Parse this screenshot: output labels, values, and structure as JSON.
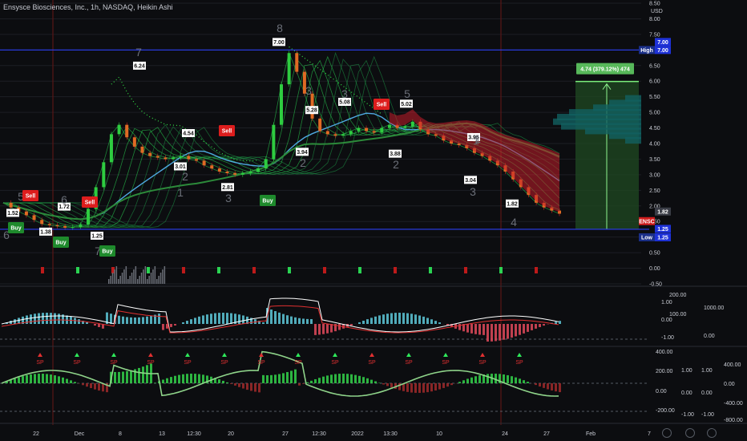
{
  "header": {
    "title": "Ensysce Biosciences, Inc., 1h, NASDAQ, Heikin Ashi",
    "currency": "USD"
  },
  "colors": {
    "background": "#0c0d10",
    "up": "#2ecc40",
    "down": "#e02424",
    "level_line": "#2b3ef0",
    "target_box": "#1f4a22",
    "target_label": "#57b85a"
  },
  "chart_data": {
    "type": "line",
    "price_axis": {
      "ticks": [
        "8.50",
        "8.00",
        "7.50",
        "7.00",
        "6.50",
        "6.00",
        "5.50",
        "5.00",
        "4.50",
        "4.00",
        "3.50",
        "3.00",
        "2.50",
        "2.00",
        "1.50",
        "1.00",
        "0.50",
        "0.00",
        "-0.50"
      ],
      "ylim": [
        -0.5,
        8.5
      ]
    },
    "time_axis": {
      "ticks": [
        "22",
        "Dec",
        "8",
        "13",
        "12:30",
        "20",
        "27",
        "12:30",
        "2022",
        "13:30",
        "10",
        "24",
        "27",
        "Feb",
        "7"
      ]
    },
    "price_series": [
      2.1,
      1.95,
      1.82,
      1.7,
      1.55,
      1.42,
      1.38,
      1.35,
      1.3,
      1.32,
      1.4,
      1.9,
      2.6,
      3.4,
      4.3,
      4.6,
      4.2,
      3.9,
      3.7,
      3.6,
      3.55,
      3.5,
      3.55,
      3.6,
      3.5,
      3.45,
      3.3,
      3.2,
      3.1,
      3.05,
      3.0,
      3.05,
      3.1,
      3.2,
      3.5,
      4.6,
      5.9,
      6.9,
      6.3,
      5.6,
      4.8,
      4.4,
      4.3,
      4.25,
      4.3,
      4.4,
      4.5,
      4.4,
      4.35,
      4.5,
      4.6,
      4.5,
      4.55,
      4.7,
      4.45,
      4.3,
      4.25,
      4.1,
      4.0,
      3.95,
      3.85,
      3.7,
      3.6,
      3.45,
      3.3,
      3.1,
      2.85,
      2.6,
      2.35,
      2.1,
      1.95,
      1.85,
      1.75
    ],
    "price_labels": [
      {
        "text": "1.52",
        "value": 1.52
      },
      {
        "text": "1.38",
        "value": 1.38
      },
      {
        "text": "1.72",
        "value": 1.72
      },
      {
        "text": "1.25",
        "value": 1.25
      },
      {
        "text": "6.24",
        "value": 6.24
      },
      {
        "text": "4.54",
        "value": 4.54
      },
      {
        "text": "3.01",
        "value": 3.01
      },
      {
        "text": "2.81",
        "value": 2.81
      },
      {
        "text": "7.00",
        "value": 7.0
      },
      {
        "text": "5.28",
        "value": 5.28
      },
      {
        "text": "5.08",
        "value": 5.08
      },
      {
        "text": "3.94",
        "value": 3.94
      },
      {
        "text": "5.02",
        "value": 5.02
      },
      {
        "text": "3.88",
        "value": 3.88
      },
      {
        "text": "3.95",
        "value": 3.95
      },
      {
        "text": "3.04",
        "value": 3.04
      },
      {
        "text": "1.82",
        "value": 1.82
      }
    ],
    "wave_labels": [
      "5",
      "6",
      "6",
      "7",
      "7",
      "1",
      "2",
      "3",
      "8",
      "3",
      "2",
      "3",
      "5",
      "1",
      "2",
      "1",
      "3",
      "4"
    ],
    "signals": [
      {
        "type": "Sell"
      },
      {
        "type": "Buy"
      },
      {
        "type": "Buy"
      },
      {
        "type": "Sell"
      },
      {
        "type": "Buy"
      },
      {
        "type": "Sell"
      },
      {
        "type": "Buy"
      },
      {
        "type": "Sell"
      }
    ],
    "levels": {
      "high_value": 7.0,
      "high_label": "High",
      "high_text": "7.00",
      "high_text2": "7.00",
      "low_value": 1.25,
      "low_label": "Low",
      "low_text": "1.25",
      "low_text2": "1.25",
      "last_value": 1.82,
      "last_text": "1.82",
      "symbol": "ENSC"
    },
    "target": {
      "text": "4.74 (379.12%) 474",
      "from": 1.25,
      "to": 5.99
    },
    "macd_axis": {
      "left_ticks": [
        "200.00",
        "1.00",
        "100.00",
        "0.00",
        "-1.00"
      ],
      "right_ticks": [
        "1000.00",
        "0.00"
      ]
    },
    "osc_axis": {
      "left_ticks": [
        "400.00",
        "200.00",
        "0.00",
        "-200.00"
      ],
      "mid_ticks": [
        "1.00",
        "0.00",
        "-1.00"
      ],
      "right_ticks": [
        "1.00",
        "0.00",
        "-1.00"
      ],
      "far_ticks": [
        "400.00",
        "0.00",
        "-400.00",
        "-800.00"
      ]
    },
    "osc_markers": [
      "SP",
      "SP",
      "SP",
      "SP",
      "SP",
      "SP",
      "SP",
      "SP",
      "SP",
      "SP",
      "SP",
      "SP",
      "SP",
      "SP"
    ]
  }
}
